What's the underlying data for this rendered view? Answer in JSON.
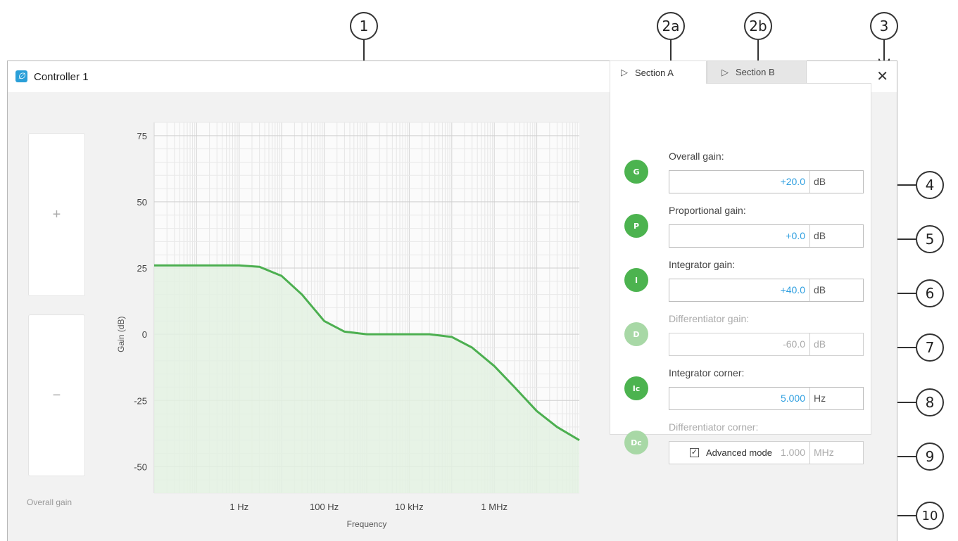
{
  "callouts": [
    "1",
    "2a",
    "2b",
    "3",
    "4",
    "5",
    "6",
    "7",
    "8",
    "9",
    "10"
  ],
  "window": {
    "title": "Controller 1",
    "close_icon": "close-icon",
    "app_icon": "controller-app-icon"
  },
  "side_controls": {
    "plus": "+",
    "minus": "−",
    "label": "Overall gain"
  },
  "tabs": [
    {
      "label": "Section A",
      "icon": "triangle-play-icon"
    },
    {
      "label": "Section B",
      "icon": "triangle-play-icon"
    }
  ],
  "params": [
    {
      "badge": "G",
      "label": "Overall gain:",
      "value": "+20.0",
      "unit": "dB",
      "enabled": true
    },
    {
      "badge": "P",
      "label": "Proportional gain:",
      "value": "+0.0",
      "unit": "dB",
      "enabled": true
    },
    {
      "badge": "I",
      "label": "Integrator gain:",
      "value": "+40.0",
      "unit": "dB",
      "enabled": true
    },
    {
      "badge": "D",
      "label": "Differentiator gain:",
      "value": "-60.0",
      "unit": "dB",
      "enabled": false
    },
    {
      "badge": "Ic",
      "label": "Integrator corner:",
      "value": "5.000",
      "unit": "Hz",
      "enabled": true
    },
    {
      "badge": "Dc",
      "label": "Differentiator corner:",
      "value": "1.000",
      "unit": "MHz",
      "enabled": false
    }
  ],
  "advanced_mode": {
    "label": "Advanced mode",
    "checked": true
  },
  "colors": {
    "enabled_badge": "#4cb34f",
    "disabled_badge": "#a8d8a6",
    "value_blue": "#2f9fe0",
    "curve": "#4caf50",
    "fill": "#e3f1e2"
  },
  "chart_data": {
    "type": "line",
    "xlabel": "Frequency",
    "ylabel": "Gain (dB)",
    "x_scale": "log",
    "xlim_hz": [
      0.01,
      100000000
    ],
    "ylim": [
      -60,
      80
    ],
    "y_ticks": [
      75,
      50,
      25,
      0,
      -25,
      -50
    ],
    "x_ticks": [
      {
        "value": 1,
        "label": "1 Hz"
      },
      {
        "value": 100,
        "label": "100 Hz"
      },
      {
        "value": 10000,
        "label": "10 kHz"
      },
      {
        "value": 1000000,
        "label": "1 MHz"
      }
    ],
    "grid": true,
    "fill_under": true,
    "series": [
      {
        "x": [
          0.01,
          0.1,
          1,
          3,
          10,
          30,
          100,
          300,
          1000,
          3000,
          10000,
          30000,
          100000,
          300000,
          1000000,
          3000000,
          10000000,
          30000000,
          100000000
        ],
        "y": [
          26,
          26,
          26,
          25.5,
          22,
          15,
          5,
          1,
          0,
          0,
          0,
          0,
          -1,
          -5,
          -12,
          -20,
          -29,
          -35,
          -40
        ]
      }
    ]
  }
}
